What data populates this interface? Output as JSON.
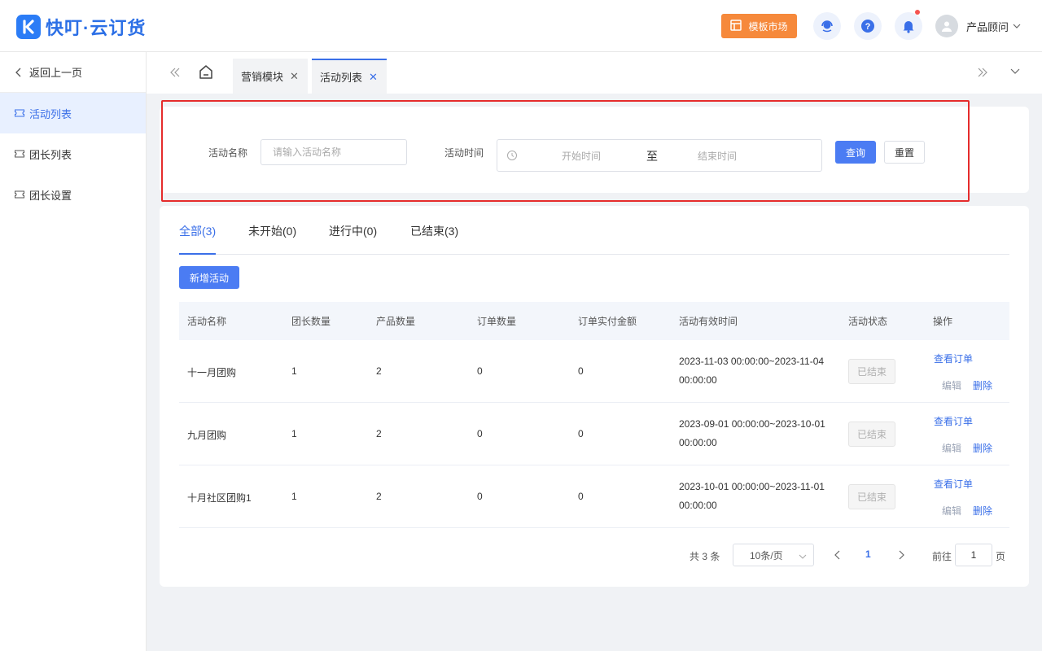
{
  "app": {
    "title": "快叮·云订货"
  },
  "header": {
    "market_label": "模板市场",
    "user_name": "产品顾问",
    "colors": {
      "brand": "#2b7cf6",
      "market": "#f6893b",
      "notice_dot": "#f5534f"
    }
  },
  "sidebar": {
    "back_label": "返回上一页",
    "items": [
      {
        "label": "活动列表",
        "active": true
      },
      {
        "label": "团长列表",
        "active": false
      },
      {
        "label": "团长设置",
        "active": false
      }
    ]
  },
  "tabs": [
    {
      "label": "营销模块",
      "active": false
    },
    {
      "label": "活动列表",
      "active": true
    }
  ],
  "search": {
    "name_label": "活动名称",
    "name_placeholder": "请输入活动名称",
    "time_label": "活动时间",
    "start_placeholder": "开始时间",
    "range_separator": "至",
    "end_placeholder": "结束时间",
    "query_button": "查询",
    "reset_button": "重置"
  },
  "status_tabs": [
    {
      "label": "全部(3)",
      "active": true
    },
    {
      "label": "未开始(0)",
      "active": false
    },
    {
      "label": "进行中(0)",
      "active": false
    },
    {
      "label": "已结束(3)",
      "active": false
    }
  ],
  "add_button": "新增活动",
  "table": {
    "headers": [
      "活动名称",
      "团长数量",
      "产品数量",
      "订单数量",
      "订单实付金额",
      "活动有效时间",
      "活动状态",
      "操作"
    ],
    "rows": [
      {
        "name": "十一月团购",
        "leaders": "1",
        "products": "2",
        "orders": "0",
        "amount": "0",
        "time_line1": "2023-11-03 00:00:00~2023-11-04",
        "time_line2": "00:00:00",
        "status": "已结束"
      },
      {
        "name": "九月团购",
        "leaders": "1",
        "products": "2",
        "orders": "0",
        "amount": "0",
        "time_line1": "2023-09-01 00:00:00~2023-10-01",
        "time_line2": "00:00:00",
        "status": "已结束"
      },
      {
        "name": "十月社区团购1",
        "leaders": "1",
        "products": "2",
        "orders": "0",
        "amount": "0",
        "time_line1": "2023-10-01 00:00:00~2023-11-01",
        "time_line2": "00:00:00",
        "status": "已结束"
      }
    ],
    "actions": {
      "view": "查看订单",
      "edit": "编辑",
      "delete": "删除"
    }
  },
  "pagination": {
    "total_text": "共 3 条",
    "page_size": "10条/页",
    "current_page": "1",
    "goto_label": "前往",
    "goto_value": "1",
    "page_suffix": "页"
  }
}
